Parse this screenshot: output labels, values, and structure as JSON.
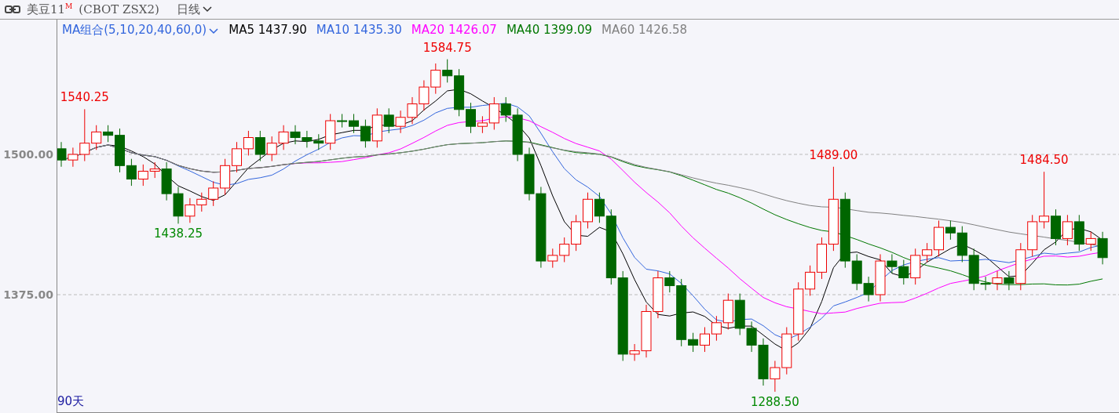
{
  "header": {
    "title": "美豆11$^{M}$",
    "code": "(CBOT ZSX2)",
    "period": "日线"
  },
  "legend": {
    "group": "MA组合(5,10,20,40,60,0)",
    "items": [
      {
        "label": "MA5 1437.90",
        "color": "#000000"
      },
      {
        "label": "MA10 1435.30",
        "color": "#3366dd"
      },
      {
        "label": "MA20 1426.07",
        "color": "#ff00ff"
      },
      {
        "label": "MA40 1399.09",
        "color": "#007700"
      },
      {
        "label": "MA60 1426.58",
        "color": "#808080"
      }
    ]
  },
  "y_axis": [
    "1500.00",
    "1375.00"
  ],
  "annotations": [
    {
      "text": "1540.25",
      "kind": "high"
    },
    {
      "text": "1438.25",
      "kind": "low"
    },
    {
      "text": "1584.75",
      "kind": "high"
    },
    {
      "text": "1489.00",
      "kind": "high"
    },
    {
      "text": "1288.50",
      "kind": "low"
    },
    {
      "text": "1484.50",
      "kind": "high"
    }
  ],
  "range_label": "90天"
}
